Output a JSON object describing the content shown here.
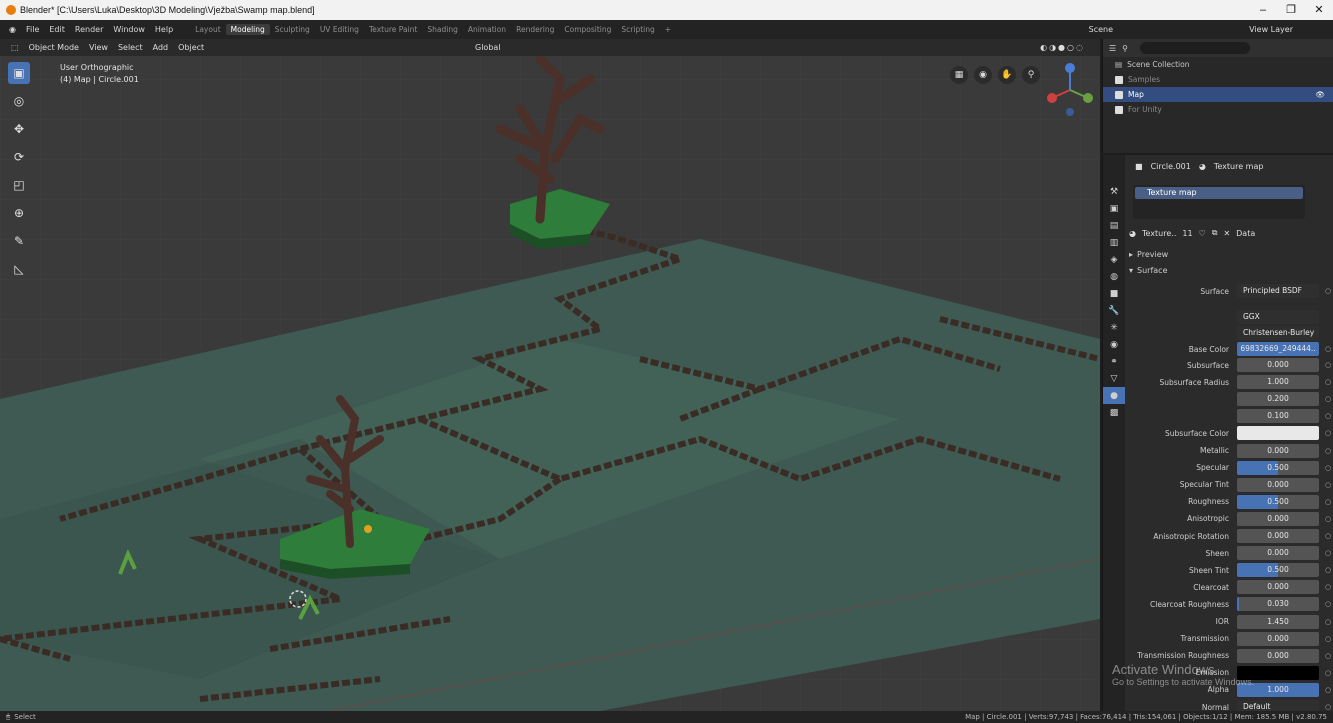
{
  "window": {
    "title": "Blender* [C:\\Users\\Luka\\Desktop\\3D Modeling\\Vježba\\Swamp map.blend]"
  },
  "menu": {
    "items": [
      "File",
      "Edit",
      "Render",
      "Window",
      "Help"
    ]
  },
  "workspaces": [
    "Layout",
    "Modeling",
    "Sculpting",
    "UV Editing",
    "Texture Paint",
    "Shading",
    "Animation",
    "Rendering",
    "Compositing",
    "Scripting"
  ],
  "active_workspace": "Modeling",
  "scene": "Scene",
  "view_layer": "View Layer",
  "viewport": {
    "mode": "Object Mode",
    "header_items": [
      "View",
      "Select",
      "Add",
      "Object"
    ],
    "orientation": "Global",
    "info_line1": "User Orthographic",
    "info_line2": "(4) Map | Circle.001"
  },
  "outliner": {
    "root": "Scene Collection",
    "collections": [
      {
        "name": "Samples",
        "selected": false,
        "dim": true
      },
      {
        "name": "Map",
        "selected": true,
        "dim": false
      },
      {
        "name": "For Unity",
        "selected": false,
        "dim": true
      }
    ]
  },
  "properties": {
    "object": "Circle.001",
    "material": "Texture map",
    "slot": "Texture map",
    "material_field": "Texture..",
    "users": "11",
    "link": "Data",
    "sections": {
      "preview": "Preview",
      "surface": "Surface"
    },
    "surface_label": "Surface",
    "surface_value": "Principled BSDF",
    "distribution": "GGX",
    "subsurface_method": "Christensen-Burley",
    "base_color_label": "Base Color",
    "base_color_value": "69832669_249444..",
    "rows": [
      {
        "label": "Subsurface",
        "value": "0.000",
        "fill": 0
      },
      {
        "label": "Subsurface Radius",
        "value": "1.000",
        "fill": 0
      },
      {
        "label": "",
        "value": "0.200",
        "fill": 0
      },
      {
        "label": "",
        "value": "0.100",
        "fill": 0
      },
      {
        "label": "Subsurface Color",
        "value": "",
        "fill": 0
      },
      {
        "label": "Metallic",
        "value": "0.000",
        "fill": 0
      },
      {
        "label": "Specular",
        "value": "0.500",
        "fill": 0.5
      },
      {
        "label": "Specular Tint",
        "value": "0.000",
        "fill": 0
      },
      {
        "label": "Roughness",
        "value": "0.500",
        "fill": 0.5
      },
      {
        "label": "Anisotropic",
        "value": "0.000",
        "fill": 0
      },
      {
        "label": "Anisotropic Rotation",
        "value": "0.000",
        "fill": 0
      },
      {
        "label": "Sheen",
        "value": "0.000",
        "fill": 0
      },
      {
        "label": "Sheen Tint",
        "value": "0.500",
        "fill": 0.5
      },
      {
        "label": "Clearcoat",
        "value": "0.000",
        "fill": 0
      },
      {
        "label": "Clearcoat Roughness",
        "value": "0.030",
        "fill": 0.03
      },
      {
        "label": "IOR",
        "value": "1.450",
        "fill": 0
      },
      {
        "label": "Transmission",
        "value": "0.000",
        "fill": 0
      },
      {
        "label": "Transmission Roughness",
        "value": "0.000",
        "fill": 0
      },
      {
        "label": "Emission",
        "value": "",
        "fill": 0
      },
      {
        "label": "Alpha",
        "value": "1.000",
        "fill": 1
      },
      {
        "label": "Normal",
        "value": "Default",
        "fill": 0
      }
    ]
  },
  "status": {
    "left": "Select",
    "right": "Map | Circle.001 | Verts:97,743 | Faces:76,414 | Tris:154,061 | Objects:1/12 | Mem: 185.5 MB | v2.80.75"
  },
  "watermark": {
    "line1": "Activate Windows",
    "line2": "Go to Settings to activate Windows."
  },
  "colors": {
    "accent": "#4772b3",
    "selected_row": "#334d80",
    "ground": "#3e5a52",
    "path": "#3a2b25",
    "grass": "#2e7d3a",
    "trunk": "#4a3028"
  }
}
